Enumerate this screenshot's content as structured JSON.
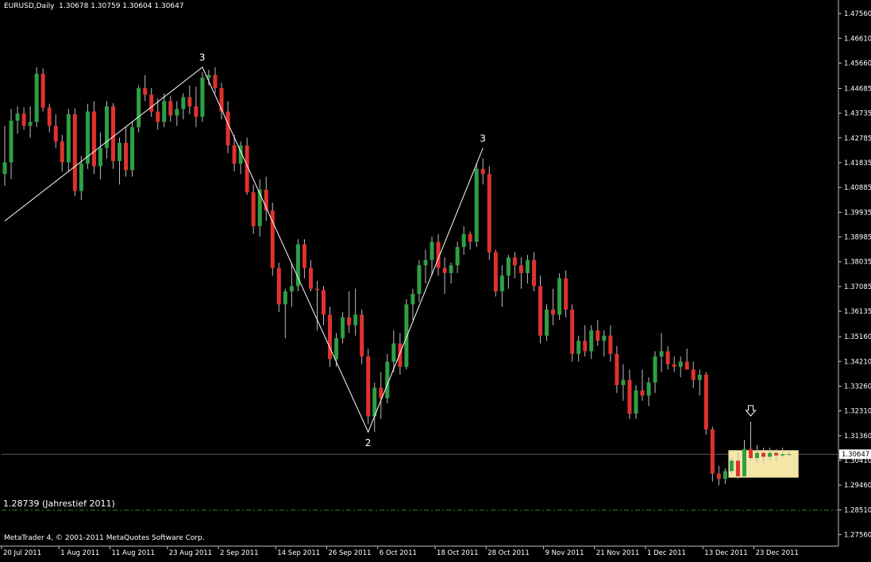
{
  "header": {
    "symbol_label": "EURUSD,Daily",
    "ohlc": "1.30678 1.30759 1.30604 1.30647"
  },
  "footer": {
    "copyright": "MetaTrader 4, © 2001-2011 MetaQuotes Software Corp."
  },
  "colors": {
    "background": "#000000",
    "bull": "#2ea043",
    "bear": "#e0322d",
    "wick": "#bdbdbd",
    "zigzag": "#ffffff",
    "axis": "#c0c0c0",
    "annotation_line": "#2e8b2e",
    "highlight_box": "#f3e6a6",
    "price_label_bg": "#ffffff"
  },
  "chart_data": {
    "type": "candlestick",
    "symbol": "EURUSD",
    "timeframe": "Daily",
    "y_axis": {
      "ylim": [
        1.2712,
        1.4802
      ],
      "ticks": [
        "1.47560",
        "1.46610",
        "1.45660",
        "1.44685",
        "1.43735",
        "1.42785",
        "1.41835",
        "1.40885",
        "1.39935",
        "1.38985",
        "1.38035",
        "1.37085",
        "1.36135",
        "1.35160",
        "1.34210",
        "1.33260",
        "1.32310",
        "1.31360",
        "1.30410",
        "1.29460",
        "1.28510",
        "1.27560"
      ]
    },
    "x_axis": {
      "ticks": [
        {
          "label": "20 Jul 2011",
          "bar": 0
        },
        {
          "label": "1 Aug 2011",
          "bar": 9
        },
        {
          "label": "11 Aug 2011",
          "bar": 17
        },
        {
          "label": "23 Aug 2011",
          "bar": 26
        },
        {
          "label": "2 Sep 2011",
          "bar": 34
        },
        {
          "label": "14 Sep 2011",
          "bar": 43
        },
        {
          "label": "26 Sep 2011",
          "bar": 51
        },
        {
          "label": "6 Oct 2011",
          "bar": 59
        },
        {
          "label": "18 Oct 2011",
          "bar": 68
        },
        {
          "label": "28 Oct 2011",
          "bar": 76
        },
        {
          "label": "9 Nov 2011",
          "bar": 85
        },
        {
          "label": "21 Nov 2011",
          "bar": 93
        },
        {
          "label": "1 Dec 2011",
          "bar": 101
        },
        {
          "label": "13 Dec 2011",
          "bar": 110
        },
        {
          "label": "23 Dec 2011",
          "bar": 118
        }
      ]
    },
    "grid": false,
    "current_price": "1.30647",
    "candles": [
      [
        1.414,
        1.4325,
        1.4095,
        1.4185
      ],
      [
        1.4185,
        1.439,
        1.412,
        1.4345
      ],
      [
        1.4345,
        1.44,
        1.4295,
        1.4372
      ],
      [
        1.4372,
        1.4396,
        1.431,
        1.4325
      ],
      [
        1.4325,
        1.44,
        1.428,
        1.434
      ],
      [
        1.434,
        1.455,
        1.432,
        1.4525
      ],
      [
        1.4525,
        1.4545,
        1.438,
        1.4395
      ],
      [
        1.4395,
        1.441,
        1.43,
        1.4325
      ],
      [
        1.4325,
        1.437,
        1.424,
        1.4265
      ],
      [
        1.4265,
        1.429,
        1.415,
        1.4185
      ],
      [
        1.4185,
        1.439,
        1.415,
        1.437
      ],
      [
        1.437,
        1.4392,
        1.4055,
        1.4075
      ],
      [
        1.4075,
        1.421,
        1.404,
        1.418
      ],
      [
        1.418,
        1.441,
        1.416,
        1.438
      ],
      [
        1.438,
        1.442,
        1.414,
        1.417
      ],
      [
        1.417,
        1.43,
        1.412,
        1.424
      ],
      [
        1.424,
        1.442,
        1.42,
        1.44
      ],
      [
        1.44,
        1.4412,
        1.416,
        1.419
      ],
      [
        1.419,
        1.428,
        1.41,
        1.426
      ],
      [
        1.426,
        1.432,
        1.413,
        1.4155
      ],
      [
        1.4155,
        1.434,
        1.413,
        1.432
      ],
      [
        1.432,
        1.448,
        1.43,
        1.447
      ],
      [
        1.447,
        1.452,
        1.442,
        1.4445
      ],
      [
        1.4445,
        1.447,
        1.436,
        1.438
      ],
      [
        1.438,
        1.443,
        1.431,
        1.434
      ],
      [
        1.434,
        1.445,
        1.432,
        1.442
      ],
      [
        1.442,
        1.444,
        1.434,
        1.4365
      ],
      [
        1.4365,
        1.442,
        1.4325,
        1.439
      ],
      [
        1.439,
        1.445,
        1.435,
        1.4435
      ],
      [
        1.4435,
        1.448,
        1.437,
        1.44
      ],
      [
        1.44,
        1.4475,
        1.432,
        1.436
      ],
      [
        1.436,
        1.453,
        1.434,
        1.451
      ],
      [
        1.451,
        1.454,
        1.448,
        1.452
      ],
      [
        1.452,
        1.455,
        1.445,
        1.447
      ],
      [
        1.447,
        1.449,
        1.435,
        1.438
      ],
      [
        1.438,
        1.442,
        1.422,
        1.425
      ],
      [
        1.425,
        1.429,
        1.415,
        1.418
      ],
      [
        1.418,
        1.4265,
        1.414,
        1.425
      ],
      [
        1.425,
        1.428,
        1.406,
        1.407
      ],
      [
        1.407,
        1.41,
        1.391,
        1.394
      ],
      [
        1.394,
        1.412,
        1.39,
        1.408
      ],
      [
        1.408,
        1.413,
        1.396,
        1.4
      ],
      [
        1.4,
        1.403,
        1.375,
        1.378
      ],
      [
        1.378,
        1.38,
        1.361,
        1.364
      ],
      [
        1.364,
        1.37,
        1.351,
        1.369
      ],
      [
        1.369,
        1.38,
        1.363,
        1.371
      ],
      [
        1.371,
        1.389,
        1.369,
        1.387
      ],
      [
        1.387,
        1.389,
        1.374,
        1.378
      ],
      [
        1.378,
        1.381,
        1.369,
        1.37
      ],
      [
        1.37,
        1.373,
        1.354,
        1.3695
      ],
      [
        1.3695,
        1.371,
        1.356,
        1.36
      ],
      [
        1.36,
        1.363,
        1.34,
        1.343
      ],
      [
        1.343,
        1.353,
        1.34,
        1.351
      ],
      [
        1.351,
        1.361,
        1.349,
        1.359
      ],
      [
        1.359,
        1.369,
        1.353,
        1.356
      ],
      [
        1.356,
        1.37,
        1.352,
        1.36
      ],
      [
        1.36,
        1.362,
        1.341,
        1.344
      ],
      [
        1.344,
        1.347,
        1.318,
        1.321
      ],
      [
        1.321,
        1.334,
        1.315,
        1.332
      ],
      [
        1.332,
        1.338,
        1.32,
        1.328
      ],
      [
        1.328,
        1.345,
        1.326,
        1.342
      ],
      [
        1.342,
        1.354,
        1.338,
        1.349
      ],
      [
        1.349,
        1.353,
        1.337,
        1.34
      ],
      [
        1.34,
        1.366,
        1.339,
        1.364
      ],
      [
        1.364,
        1.37,
        1.358,
        1.368
      ],
      [
        1.368,
        1.381,
        1.365,
        1.379
      ],
      [
        1.379,
        1.385,
        1.372,
        1.381
      ],
      [
        1.381,
        1.39,
        1.375,
        1.388
      ],
      [
        1.388,
        1.391,
        1.375,
        1.378
      ],
      [
        1.378,
        1.382,
        1.368,
        1.376
      ],
      [
        1.376,
        1.38,
        1.372,
        1.379
      ],
      [
        1.379,
        1.388,
        1.376,
        1.386
      ],
      [
        1.386,
        1.394,
        1.383,
        1.391
      ],
      [
        1.391,
        1.392,
        1.385,
        1.388
      ],
      [
        1.388,
        1.418,
        1.386,
        1.416
      ],
      [
        1.416,
        1.42,
        1.41,
        1.414
      ],
      [
        1.414,
        1.417,
        1.381,
        1.384
      ],
      [
        1.384,
        1.385,
        1.367,
        1.369
      ],
      [
        1.369,
        1.379,
        1.363,
        1.375
      ],
      [
        1.375,
        1.383,
        1.37,
        1.382
      ],
      [
        1.382,
        1.384,
        1.374,
        1.379
      ],
      [
        1.379,
        1.382,
        1.37,
        1.376
      ],
      [
        1.376,
        1.383,
        1.372,
        1.381
      ],
      [
        1.381,
        1.384,
        1.369,
        1.371
      ],
      [
        1.371,
        1.375,
        1.349,
        1.352
      ],
      [
        1.352,
        1.364,
        1.35,
        1.362
      ],
      [
        1.362,
        1.37,
        1.356,
        1.36
      ],
      [
        1.36,
        1.376,
        1.358,
        1.374
      ],
      [
        1.374,
        1.377,
        1.359,
        1.362
      ],
      [
        1.362,
        1.364,
        1.342,
        1.345
      ],
      [
        1.345,
        1.352,
        1.342,
        1.35
      ],
      [
        1.35,
        1.356,
        1.344,
        1.346
      ],
      [
        1.346,
        1.356,
        1.343,
        1.354
      ],
      [
        1.354,
        1.358,
        1.348,
        1.35
      ],
      [
        1.35,
        1.354,
        1.344,
        1.352
      ],
      [
        1.352,
        1.356,
        1.342,
        1.345
      ],
      [
        1.345,
        1.348,
        1.33,
        1.333
      ],
      [
        1.333,
        1.341,
        1.327,
        1.335
      ],
      [
        1.335,
        1.339,
        1.32,
        1.322
      ],
      [
        1.322,
        1.333,
        1.32,
        1.331
      ],
      [
        1.331,
        1.339,
        1.327,
        1.329
      ],
      [
        1.329,
        1.336,
        1.325,
        1.334
      ],
      [
        1.334,
        1.346,
        1.33,
        1.344
      ],
      [
        1.344,
        1.353,
        1.338,
        1.346
      ],
      [
        1.346,
        1.348,
        1.339,
        1.341
      ],
      [
        1.341,
        1.344,
        1.338,
        1.34
      ],
      [
        1.34,
        1.344,
        1.336,
        1.342
      ],
      [
        1.342,
        1.347,
        1.339,
        1.339
      ],
      [
        1.339,
        1.342,
        1.332,
        1.335
      ],
      [
        1.335,
        1.339,
        1.329,
        1.337
      ],
      [
        1.337,
        1.338,
        1.314,
        1.316
      ],
      [
        1.316,
        1.317,
        1.296,
        1.299
      ],
      [
        1.299,
        1.302,
        1.2945,
        1.297
      ],
      [
        1.297,
        1.301,
        1.295,
        1.3
      ],
      [
        1.3,
        1.305,
        1.299,
        1.304
      ],
      [
        1.304,
        1.307,
        1.297,
        1.298
      ],
      [
        1.298,
        1.312,
        1.2975,
        1.3085
      ],
      [
        1.3085,
        1.319,
        1.304,
        1.305
      ],
      [
        1.305,
        1.31,
        1.303,
        1.307
      ],
      [
        1.307,
        1.309,
        1.303,
        1.3055
      ],
      [
        1.3055,
        1.309,
        1.304,
        1.307
      ],
      [
        1.307,
        1.3085,
        1.304,
        1.306
      ],
      [
        1.306,
        1.309,
        1.305,
        1.3065
      ],
      [
        1.3065,
        1.3076,
        1.306,
        1.3065
      ]
    ],
    "zigzag": [
      {
        "bar": 0,
        "price": 1.396,
        "label": ""
      },
      {
        "bar": 31,
        "price": 1.455,
        "label": "3"
      },
      {
        "bar": 57,
        "price": 1.315,
        "label": "2"
      },
      {
        "bar": 75,
        "price": 1.424,
        "label": "3"
      }
    ],
    "annotations": {
      "year_low_label": "1.28739 (Jahrestief 2011)",
      "year_low_level": 1.285,
      "arrow_bar": 117,
      "arrow_price": 1.323,
      "highlight_from_bar": 114,
      "highlight_to_bar": 124,
      "highlight_high": 1.308,
      "highlight_low": 1.2975
    }
  }
}
